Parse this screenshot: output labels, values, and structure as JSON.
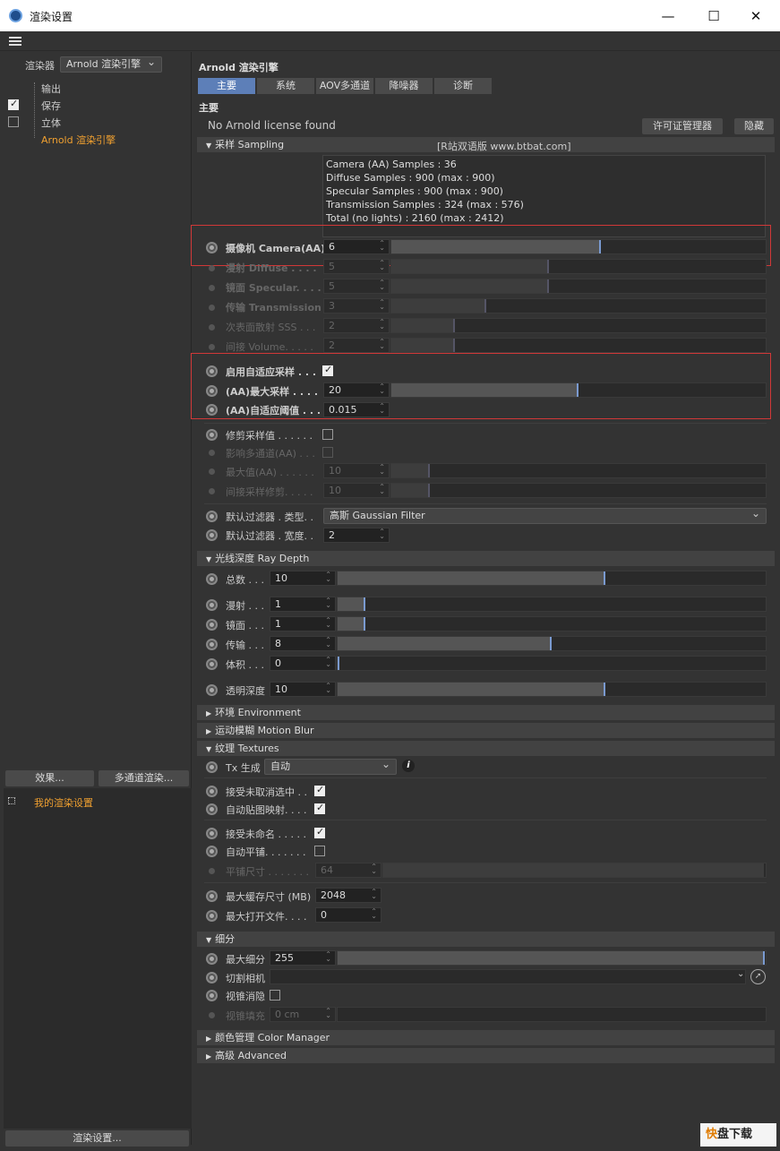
{
  "window": {
    "title": "渲染设置",
    "min": "—",
    "max": "☐",
    "close": "✕"
  },
  "left": {
    "renderer_label": "渲染器",
    "renderer_value": "Arnold 渲染引擎",
    "tree": [
      "输出",
      "保存",
      "立体",
      "Arnold 渲染引擎"
    ],
    "effects_btn": "效果...",
    "multipass_btn": "多通道渲染...",
    "my_settings": "我的渲染设置",
    "bottom_btn": "渲染设置..."
  },
  "main": {
    "title": "Arnold 渲染引擎",
    "tabs": [
      "主要",
      "系统",
      "AOV多通道",
      "降噪器",
      "诊断"
    ],
    "section_label": "主要",
    "license_msg": "No Arnold license found",
    "license_btn": "许可证管理器",
    "hide_btn": "隐藏",
    "sampling_header": "采样 Sampling",
    "watermark_text": "[R站双语版 www.btbat.com]",
    "info_lines": [
      "Camera (AA) Samples : 36",
      "Diffuse Samples : 900 (max : 900)",
      "Specular Samples : 900 (max : 900)",
      "Transmission Samples : 324 (max : 576)",
      "Total (no lights) : 2160 (max : 2412)"
    ],
    "samples": [
      {
        "label": "摄像机 Camera(AA)",
        "value": "6",
        "fill": 0.55,
        "enabled": true,
        "bold": true
      },
      {
        "label": "漫射 Diffuse . . . .",
        "value": "5",
        "fill": 0.5,
        "enabled": false,
        "bold": true
      },
      {
        "label": "镜面 Specular. . . .",
        "value": "5",
        "fill": 0.5,
        "enabled": false,
        "bold": true
      },
      {
        "label": "传输 Transmission",
        "value": "3",
        "fill": 0.3,
        "enabled": false,
        "bold": true
      },
      {
        "label": "次表面散射 SSS . . .",
        "value": "2",
        "fill": 0.2,
        "enabled": false,
        "bold": false
      },
      {
        "label": "间接 Volume. . . . .",
        "value": "2",
        "fill": 0.2,
        "enabled": false,
        "bold": false
      }
    ],
    "adaptive": {
      "enable_label": "启用自适应采样 . . .",
      "max_label": "(AA)最大采样 . . . .",
      "max_value": "20",
      "max_fill": 0.5,
      "thresh_label": "(AA)自适应阈值 . . .",
      "thresh_value": "0.015"
    },
    "clamp": {
      "label": "修剪采样值 . . . . . .",
      "aov_label": "影响多通道(AA) . . .",
      "max_label": "最大值(AA) . . . . . .",
      "max_value": "10",
      "indirect_label": "间接采样修剪. . . . .",
      "indirect_value": "10"
    },
    "filter": {
      "type_label": "默认过滤器 . 类型. .",
      "type_value": "高斯 Gaussian Filter",
      "width_label": "默认过滤器 . 宽度. .",
      "width_value": "2"
    },
    "ray_header": "光线深度 Ray Depth",
    "ray": [
      {
        "label": "总数 . . .",
        "value": "10",
        "fill": 0.625
      },
      {
        "label": "漫射 . . .",
        "value": "1",
        "fill": 0.0625
      },
      {
        "label": "镜面 . . .",
        "value": "1",
        "fill": 0.0625
      },
      {
        "label": "传输 . . .",
        "value": "8",
        "fill": 0.5
      },
      {
        "label": "体积 . . .",
        "value": "0",
        "fill": 0.0
      },
      {
        "label": "透明深度",
        "value": "10",
        "fill": 0.625
      }
    ],
    "env_header": "环境 Environment",
    "motion_header": "运动模糊 Motion Blur",
    "tex_header": "纹理 Textures",
    "tex": {
      "tx_label": "Tx 生成",
      "tx_value": "自动",
      "info_icon": "i",
      "accept_unmipped": "接受未取消选中 . .",
      "auto_tile": "自动贴图映射. . . .",
      "accept_untiled": "接受未命名 . . . . .",
      "auto_tile2": "自动平铺. . . . . . .",
      "tile_size_label": "平铺尺寸 . . . . . . .",
      "tile_size_value": "64",
      "cache_label": "最大缓存尺寸 (MB)",
      "cache_value": "2048",
      "open_label": "最大打开文件. . . .",
      "open_value": "0"
    },
    "subdiv_header": "细分",
    "subdiv": {
      "max_label": "最大细分",
      "max_value": "255",
      "cam_label": "切割相机",
      "frustum_label": "视锥消隐",
      "padding_label": "视锥填充",
      "padding_value": "0 cm"
    },
    "color_header": "颜色管理 Color Manager",
    "adv_header": "高级 Advanced"
  },
  "watermark": {
    "logo": "快",
    "text": "盘下载"
  }
}
